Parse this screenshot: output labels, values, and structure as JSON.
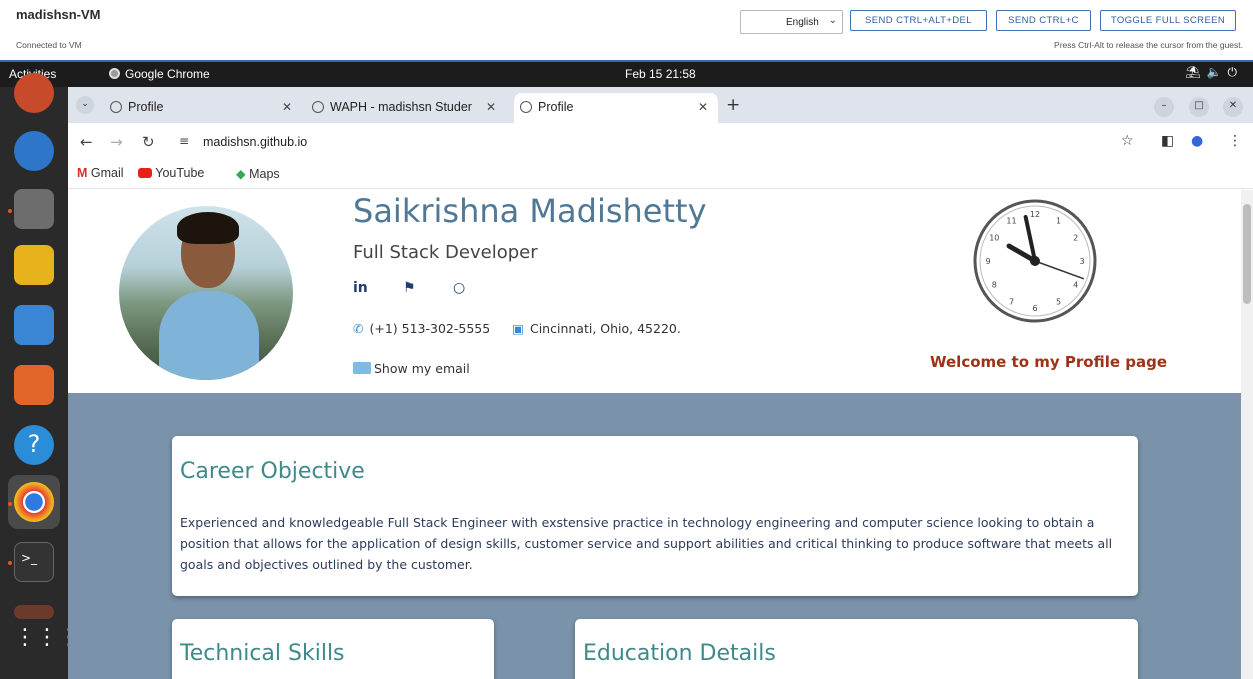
{
  "vm": {
    "title": "madishsn-VM",
    "status": "Connected to VM",
    "hint": "Press Ctrl-Alt to release the cursor from the guest.",
    "language": "English",
    "buttons": [
      "SEND CTRL+ALT+DEL",
      "SEND CTRL+C",
      "TOGGLE FULL SCREEN"
    ]
  },
  "panel": {
    "activities": "Activities",
    "app": "Google Chrome",
    "datetime": "Feb 15  21:58"
  },
  "browser": {
    "tabs": [
      "Profile",
      "WAPH - madishsn Studer",
      "Profile"
    ],
    "url": "madishsn.github.io",
    "bookmarks": [
      "Gmail",
      "YouTube",
      "Maps"
    ]
  },
  "profile": {
    "name": "Saikrishna Madishetty",
    "role": "Full Stack Developer",
    "phone": "(+1) 513-302-5555",
    "location": "Cincinnati, Ohio, 45220.",
    "email_link": "Show my email",
    "welcome": "Welcome to my Profile page",
    "socials": [
      "in",
      "⚑",
      "○"
    ]
  },
  "sections": {
    "career_title": "Career Objective",
    "career_text": "Experienced and knowledgeable Full Stack Engineer with exstensive practice in technology engineering and computer science looking to obtain a position that allows for the application of design skills, customer service and support abilities and critical thinking to produce software that meets all goals and objectives outlined by the customer.",
    "skills_title": "Technical Skills",
    "education_title": "Education Details"
  },
  "clock": {
    "numbers": [
      "12",
      "1",
      "2",
      "3",
      "4",
      "5",
      "6",
      "7",
      "8",
      "9",
      "10",
      "11"
    ],
    "hour_angle": 300,
    "minute_angle": 348,
    "second_angle": 110
  },
  "colors": {
    "accent": "#4f7896",
    "page_bg": "#7a93aa",
    "welcome": "#9c3319",
    "card_title": "#3e8a8a"
  }
}
